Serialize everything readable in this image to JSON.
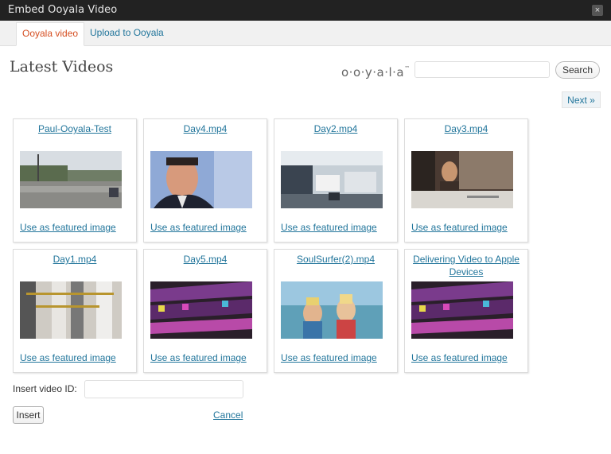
{
  "window": {
    "title": "Embed Ooyala Video",
    "close_icon": "×"
  },
  "tabs": [
    {
      "label": "Ooyala video",
      "active": true
    },
    {
      "label": "Upload to Ooyala",
      "active": false
    }
  ],
  "header": {
    "title": "Latest Videos",
    "logo_text": "o·o·y·a·l·a",
    "logo_tm": "™",
    "search_value": "",
    "search_button": "Search",
    "next_button": "Next »"
  },
  "videos": [
    {
      "title": "Paul-Ooyala-Test",
      "featured_label": "Use as featured image"
    },
    {
      "title": "Day4.mp4",
      "featured_label": "Use as featured image"
    },
    {
      "title": "Day2.mp4",
      "featured_label": "Use as featured image"
    },
    {
      "title": "Day3.mp4",
      "featured_label": "Use as featured image"
    },
    {
      "title": "Day1.mp4",
      "featured_label": "Use as featured image"
    },
    {
      "title": "Day5.mp4",
      "featured_label": "Use as featured image"
    },
    {
      "title": "SoulSurfer(2).mp4",
      "featured_label": "Use as featured image"
    },
    {
      "title": "Delivering Video to Apple Devices",
      "featured_label": "Use as featured image"
    }
  ],
  "footer": {
    "video_id_label": "Insert video ID:",
    "video_id_value": "",
    "insert_button": "Insert",
    "cancel_link": "Cancel"
  },
  "colors": {
    "link": "#21759b",
    "active_tab": "#d54e21",
    "titlebar": "#222222"
  }
}
